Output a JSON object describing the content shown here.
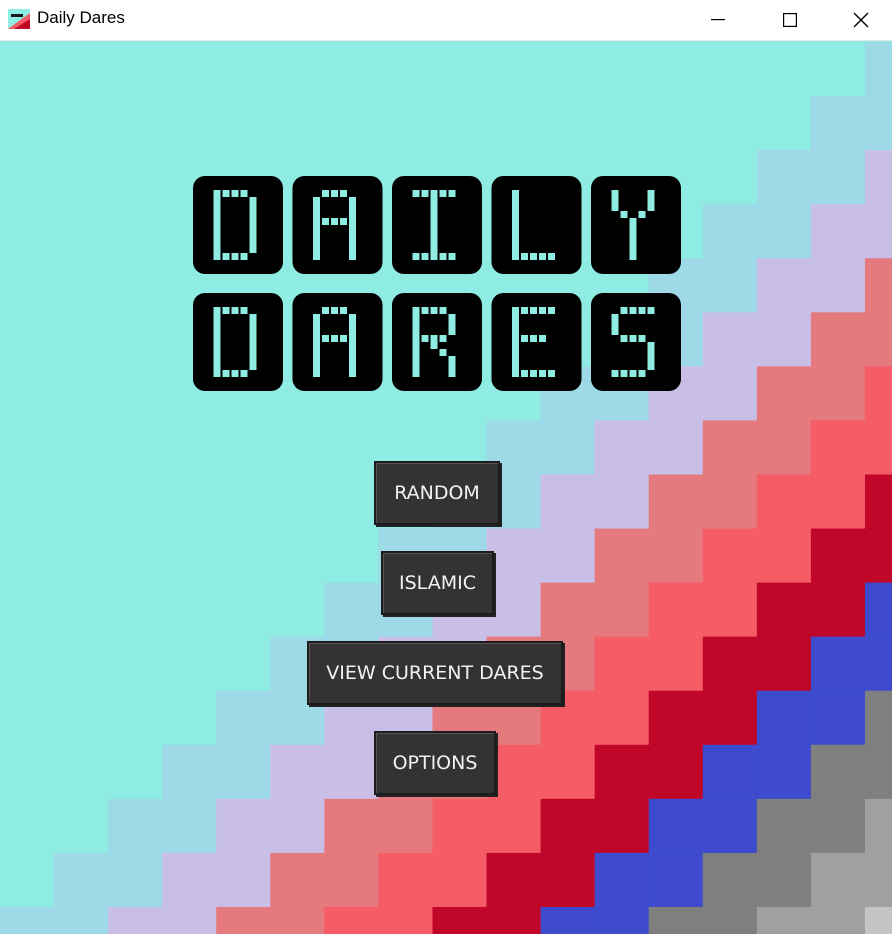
{
  "window": {
    "title": "Daily Dares"
  },
  "logo": {
    "line1": "DAILY",
    "line2": "DARES"
  },
  "menu": {
    "random": "RANDOM",
    "islamic": "ISLAMIC",
    "view_current": "VIEW CURRENT DARES",
    "options": "OPTIONS"
  },
  "colors": {
    "mint": "#8eece2",
    "sky": "#9dd9e6",
    "lavender": "#c9bfe6",
    "salmon": "#e57a7e",
    "coral": "#f55c66",
    "crimson": "#c0072a",
    "blue": "#3d4bcc",
    "gray": "#7f7f7f",
    "silver": "#a0a0a0",
    "light_silver": "#c4c4c4",
    "button_bg": "#333333",
    "logo_fill": "#000000"
  }
}
